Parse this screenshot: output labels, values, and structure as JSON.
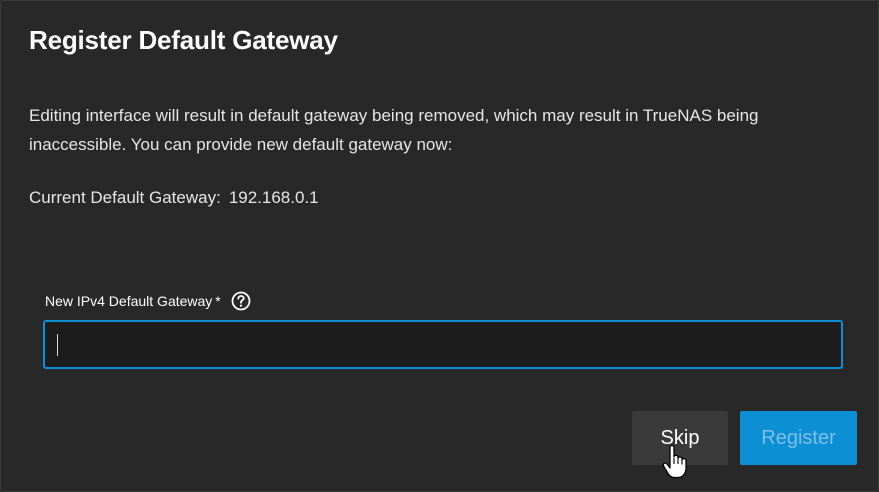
{
  "dialog": {
    "title": "Register Default Gateway",
    "message": "Editing interface will result in default gateway being removed, which may result in TrueNAS being inaccessible. You can provide new default gateway now:",
    "current_gateway_label": "Current Default Gateway:",
    "current_gateway_value": "192.168.0.1"
  },
  "form": {
    "gateway_field": {
      "label": "New IPv4 Default Gateway",
      "required_marker": "*",
      "value": "",
      "placeholder": "",
      "help_icon": "help-circle-icon"
    }
  },
  "actions": {
    "skip_label": "Skip",
    "register_label": "Register"
  },
  "pointer": {
    "icon": "hand-pointer-icon"
  },
  "colors": {
    "dialog_background": "#282828",
    "accent": "#0d8fd6",
    "skip_button": "#3a3a3a",
    "register_text_disabled": "#7ec0e6"
  }
}
